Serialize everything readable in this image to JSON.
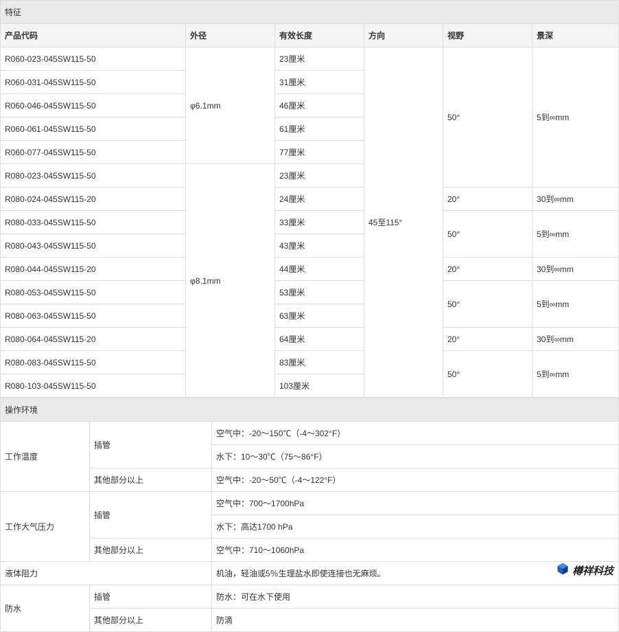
{
  "spec": {
    "title": "特征",
    "headers": [
      "产品代码",
      "外径",
      "有效长度",
      "方向",
      "视野",
      "景深"
    ],
    "rows": [
      {
        "code": "R060-023-045SW115-50",
        "len": "23厘米"
      },
      {
        "code": "R060-031-045SW115-50",
        "len": "31厘米"
      },
      {
        "code": "R060-046-045SW115-50",
        "len": "46厘米"
      },
      {
        "code": "R060-061-045SW115-50",
        "len": "61厘米"
      },
      {
        "code": "R060-077-045SW115-50",
        "len": "77厘米"
      },
      {
        "code": "R080-023-045SW115-50",
        "len": "23厘米"
      },
      {
        "code": "R080-024-045SW115-20",
        "len": "24厘米"
      },
      {
        "code": "R080-033-045SW115-50",
        "len": "33厘米"
      },
      {
        "code": "R080-043-045SW115-50",
        "len": "43厘米"
      },
      {
        "code": "R080-044-045SW115-20",
        "len": "44厘米"
      },
      {
        "code": "R080-053-045SW115-50",
        "len": "53厘米"
      },
      {
        "code": "R080-063-045SW115-50",
        "len": "63厘米"
      },
      {
        "code": "R080-064-045SW115-20",
        "len": "64厘米"
      },
      {
        "code": "R080-083-045SW115-50",
        "len": "83厘米"
      },
      {
        "code": "R080-103-045SW115-50",
        "len": "103厘米"
      }
    ],
    "dia1": "φ6.1mm",
    "dia2": "φ8.1mm",
    "direction": "45至115°",
    "fov50": "50°",
    "fov20": "20°",
    "dof5": "5到∞mm",
    "dof30": "30到∞mm"
  },
  "env": {
    "title": "操作环境",
    "labels": {
      "work_temp": "工作温度",
      "tube": "插管",
      "other_parts": "其他部分以上",
      "pressure": "工作大气压力",
      "liquid": "液体阻力",
      "waterproof": "防水"
    },
    "values": {
      "temp_air": "空气中：-20〜150℃（-4〜302°F）",
      "temp_water": "水下：10〜30℃（75〜86°F）",
      "temp_other": "空气中：-20〜50℃（-4〜122°F）",
      "pres_air": "空气中：700〜1700hPa",
      "pres_water": "水下：高达1700 hPa",
      "pres_other": "空气中：710〜1060hPa",
      "liquid": "机油，轻油或5％生理盐水即使连接也无麻烦。",
      "wp_tube": "防水：可在水下使用",
      "wp_other": "防滴"
    }
  },
  "brand": "樽祥科技"
}
